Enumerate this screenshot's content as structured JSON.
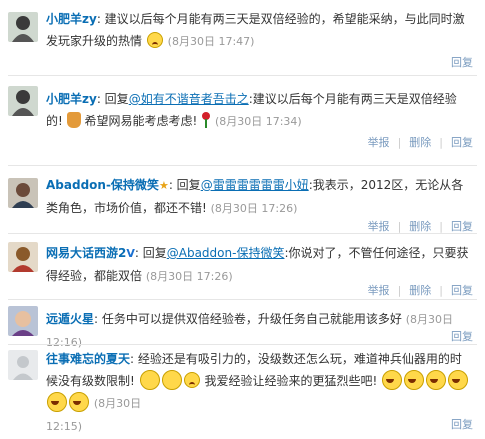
{
  "comments": [
    {
      "name": "小肥羊zy",
      "text": "建议以后每个月能有两三天是双倍经验的，希望能采纳，与此同时激发玩家升级的热情",
      "time": "(8月30日 17:47)",
      "actions": [
        "回复"
      ]
    },
    {
      "name": "小肥羊zy",
      "reply_prefix": "回复",
      "mention": "@如有不谐音者吾击之",
      "text_a": "建议以后每个月能有两三天是双倍经验的!",
      "text_b": "希望网易能考虑考虑!",
      "time": "(8月30日 17:34)",
      "actions": [
        "举报",
        "删除",
        "回复"
      ]
    },
    {
      "name": "Abaddon-保持微笑",
      "reply_prefix": "回复",
      "mention": "@雷雷雷雷雷雷小妞",
      "text": "我表示，2012区，无论从各类角色，市场价值，都还不错!",
      "time": "(8月30日 17:26)",
      "actions": [
        "举报",
        "删除",
        "回复"
      ]
    },
    {
      "name": "网易大话西游2",
      "reply_prefix": "回复",
      "mention": "@Abaddon-保持微笑",
      "text": "你说对了，不管任何途径，只要获得经验，都能双倍",
      "time": "(8月30日 17:26)",
      "actions": [
        "举报",
        "删除",
        "回复"
      ]
    },
    {
      "name": "远遁火星",
      "text": "任务中可以提供双倍经验卷，升级任务自己就能用该多好",
      "time": "(8月30日 12:16)",
      "actions": [
        "回复"
      ]
    },
    {
      "name": "往事难忘的夏天",
      "text_a": "经验还是有吸引力的，没级数还怎么玩，难道神兵仙器用的时候没有级数限制!",
      "text_b": "我爱经验让经验来的更猛烈些吧!",
      "time": "(8月30日",
      "time_b": "12:15)",
      "actions": [
        "回复"
      ]
    }
  ],
  "colors": {
    "link": "#0a6eb4",
    "muted": "#999999",
    "action": "#7a9bbf"
  }
}
